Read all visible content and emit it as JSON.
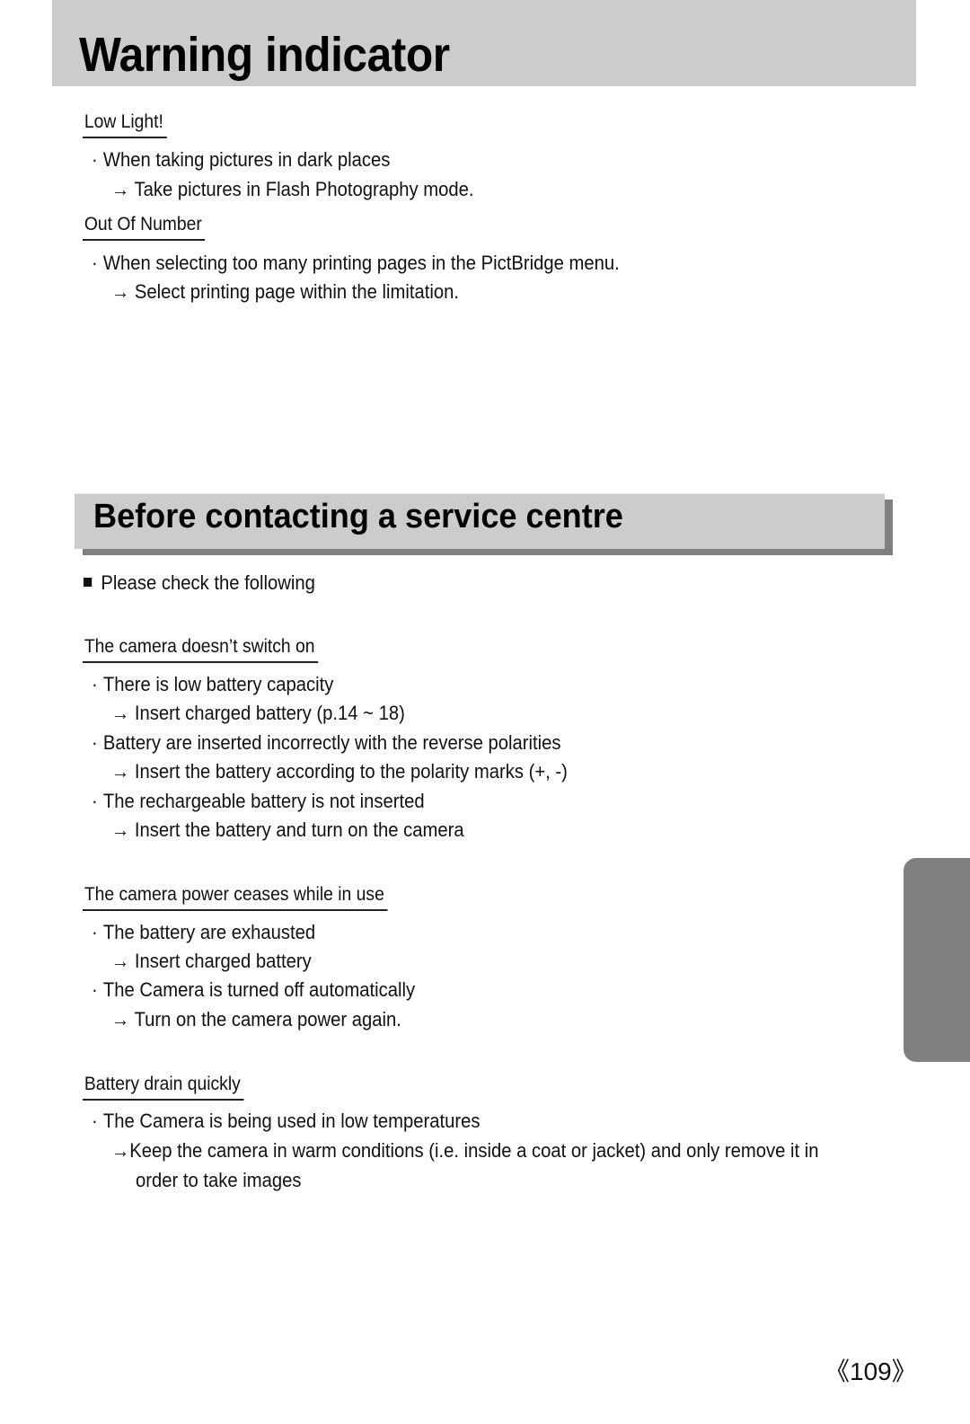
{
  "page_title": "Warning indicator",
  "warnings": [
    {
      "heading": "Low Light!",
      "items": [
        {
          "cause": "When taking pictures in dark places",
          "remedy": "Take pictures in Flash Photography mode."
        }
      ]
    },
    {
      "heading": "Out Of Number",
      "items": [
        {
          "cause": "When selecting too many printing pages in the PictBridge menu.",
          "remedy": "Select printing page within the limitation."
        }
      ]
    }
  ],
  "service": {
    "title": "Before contacting a service centre",
    "intro": "Please check the following",
    "sections": [
      {
        "heading": "The camera doesn’t switch on",
        "items": [
          {
            "cause": "There is low battery capacity",
            "remedy": "Insert charged battery (p.14 ~ 18)"
          },
          {
            "cause": "Battery are inserted incorrectly with the reverse polarities",
            "remedy": "Insert the battery according to the polarity marks (+, -)"
          },
          {
            "cause": "The rechargeable battery is not inserted",
            "remedy": "Insert the battery and turn on the camera"
          }
        ]
      },
      {
        "heading": "The camera power ceases while in use",
        "items": [
          {
            "cause": "The battery are exhausted",
            "remedy": "Insert charged battery"
          },
          {
            "cause": "The Camera is turned off automatically",
            "remedy": "Turn on the camera power again."
          }
        ]
      },
      {
        "heading": "Battery drain quickly",
        "items": [
          {
            "cause": "The Camera is being used in low temperatures",
            "remedy": "Keep the camera in warm conditions (i.e. inside a coat or jacket) and only remove it in",
            "remedy_cont": "order to take images"
          }
        ]
      }
    ]
  },
  "symbols": {
    "bullet": "·",
    "arrow": "→"
  },
  "page_number": "《109》",
  "colors": {
    "band": "#cccccc",
    "shadow": "#808080",
    "side_tab": "#808080"
  }
}
